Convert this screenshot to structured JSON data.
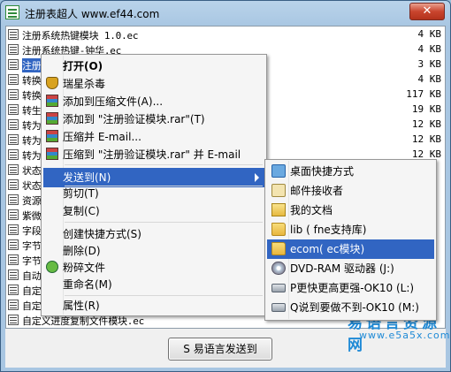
{
  "window": {
    "title": "注册表超人 www.ef44.com",
    "close_label": "✕"
  },
  "files": [
    {
      "name": "注册系统热键模块 1.0.ec",
      "size": "4 KB"
    },
    {
      "name": "注册系统热键-钟华.ec",
      "size": "4 KB"
    },
    {
      "name": "注册表",
      "size": "3 KB",
      "selected": true
    },
    {
      "name": "转换",
      "size": "4 KB"
    },
    {
      "name": "转换",
      "size": "117 KB"
    },
    {
      "name": "转生",
      "size": "19 KB"
    },
    {
      "name": "转为",
      "size": "12 KB"
    },
    {
      "name": "转为",
      "size": "12 KB"
    },
    {
      "name": "转为",
      "size": "12 KB"
    },
    {
      "name": "状态",
      "size": ""
    },
    {
      "name": "状态",
      "size": ""
    },
    {
      "name": "资源",
      "size": ""
    },
    {
      "name": "紫微",
      "size": ""
    },
    {
      "name": "字段",
      "size": ""
    },
    {
      "name": "字节",
      "size": ""
    },
    {
      "name": "字节",
      "size": ""
    },
    {
      "name": "自动",
      "size": ""
    },
    {
      "name": "自定",
      "size": ""
    },
    {
      "name": "自定",
      "size": ""
    },
    {
      "name": "自定义进度复制文件模块.ec",
      "size": ""
    }
  ],
  "context_menu": {
    "items": [
      {
        "label": "打开(O)",
        "icon": "",
        "bold": true
      },
      {
        "label": "瑞星杀毒",
        "icon": "shield-icon"
      },
      {
        "label": "添加到压缩文件(A)...",
        "icon": "rar-icon"
      },
      {
        "label": "添加到 \"注册验证模块.rar\"(T)",
        "icon": "rar-icon"
      },
      {
        "label": "压缩并 E-mail...",
        "icon": "rar-icon"
      },
      {
        "label": "压缩到 \"注册验证模块.rar\" 并 E-mail",
        "icon": "rar-icon"
      },
      {
        "label": "发送到(N)",
        "icon": "",
        "highlighted": true,
        "submenu": true
      },
      {
        "label": "剪切(T)",
        "icon": ""
      },
      {
        "label": "复制(C)",
        "icon": ""
      },
      {
        "label": "创建快捷方式(S)",
        "icon": ""
      },
      {
        "label": "删除(D)",
        "icon": ""
      },
      {
        "label": "粉碎文件",
        "icon": "shredder-icon"
      },
      {
        "label": "重命名(M)",
        "icon": ""
      },
      {
        "label": "属性(R)",
        "icon": ""
      }
    ]
  },
  "send_to_menu": {
    "items": [
      {
        "label": "桌面快捷方式",
        "icon": "desktop-icon"
      },
      {
        "label": "邮件接收者",
        "icon": "mail-icon"
      },
      {
        "label": "我的文档",
        "icon": "documents-icon"
      },
      {
        "label": "lib ( fne支持库)",
        "icon": "folder-icon"
      },
      {
        "label": "ecom( ec模块)",
        "icon": "folder-icon",
        "highlighted": true
      },
      {
        "label": "DVD-RAM 驱动器 (J:)",
        "icon": "dvd-drive-icon"
      },
      {
        "label": "P更快更高更强-OK10 (L:)",
        "icon": "drive-icon"
      },
      {
        "label": "Q说到要做不到-OK10 (M:)",
        "icon": "drive-icon"
      }
    ]
  },
  "bottom": {
    "send_button_label": "S 易语言发送到"
  },
  "watermark": {
    "brand": "易语言资源网",
    "url": "www.e5a5x.com"
  }
}
